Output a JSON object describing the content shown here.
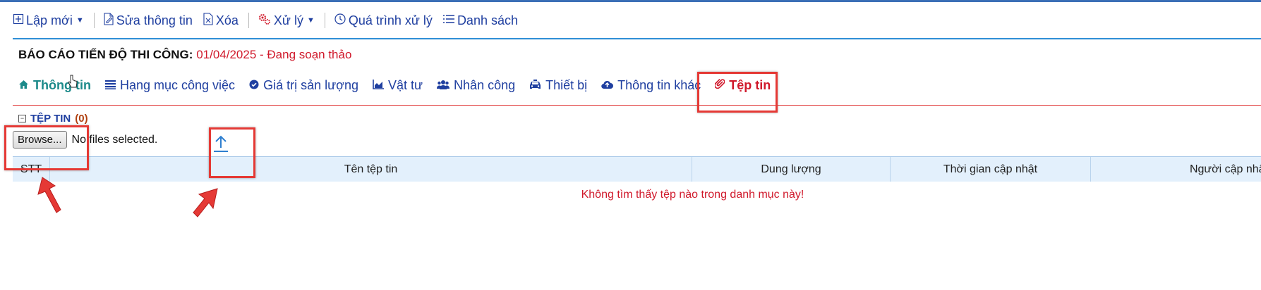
{
  "toolbar": {
    "new_label": "Lập mới",
    "edit_label": "Sửa thông tin",
    "delete_label": "Xóa",
    "process_label": "Xử lý",
    "history_label": "Quá trình xử lý",
    "list_label": "Danh sách"
  },
  "report": {
    "title": "BÁO CÁO TIẾN ĐỘ THI CÔNG:",
    "status": "01/04/2025 - Đang soạn thảo"
  },
  "tabs": [
    {
      "label": "Thông tin",
      "icon": "home-icon"
    },
    {
      "label": "Hạng mục công việc",
      "icon": "list-icon"
    },
    {
      "label": "Giá trị sản lượng",
      "icon": "check-circle-icon"
    },
    {
      "label": "Vật tư",
      "icon": "chart-area-icon"
    },
    {
      "label": "Nhân công",
      "icon": "users-icon"
    },
    {
      "label": "Thiết bị",
      "icon": "taxi-icon"
    },
    {
      "label": "Thông tin khác",
      "icon": "cloud-upload-icon"
    },
    {
      "label": "Tệp tin",
      "icon": "paperclip-icon",
      "active": true
    }
  ],
  "files_section": {
    "title": "TỆP TIN",
    "count": "(0)",
    "browse_label": "Browse...",
    "no_files_text": "No files selected."
  },
  "table": {
    "columns": [
      "STT",
      "Tên tệp tin",
      "Dung lượng",
      "Thời gian cập nhật",
      "Người cập nhật"
    ],
    "empty_message": "Không tìm thấy tệp nào trong danh mục này!"
  },
  "colors": {
    "accent_blue": "#1f3fa0",
    "active_red": "#d0192b",
    "header_bg": "#e3f0fc",
    "highlight": "#e53935"
  }
}
